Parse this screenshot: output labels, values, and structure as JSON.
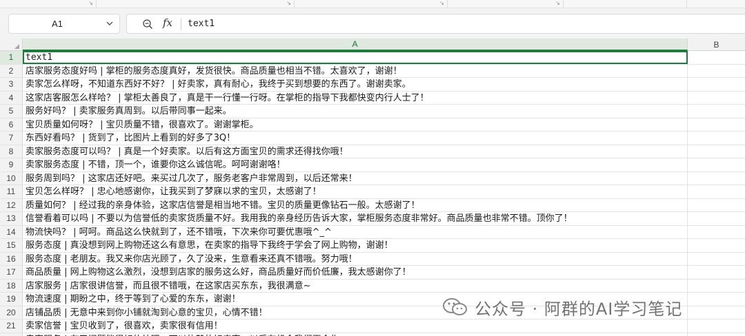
{
  "formula_bar": {
    "cell_reference": "A1",
    "fx_label": "fx",
    "content": "text1"
  },
  "columns": [
    "A",
    "B"
  ],
  "rows": [
    {
      "num": "1",
      "a": "text1"
    },
    {
      "num": "2",
      "a": "店家服务态度好吗 | 掌柜的服务态度真好，发货很快。商品质量也相当不错。太喜欢了，谢谢！"
    },
    {
      "num": "3",
      "a": "卖家怎么样呀，不知道东西好不好？ | 好卖家，真有耐心，我终于买到想要的东西了。谢谢卖家。"
    },
    {
      "num": "4",
      "a": "这家店客服怎么样哈？ | 掌柜太善良了，真是干一行懂一行呀。在掌柜的指导下我都快变内行人士了！"
    },
    {
      "num": "5",
      "a": "服务好吗？ | 卖家服务真周到。以后带同事一起来。"
    },
    {
      "num": "6",
      "a": "宝贝质量如何呀？ | 宝贝质量不错，很喜欢了。谢谢掌柜。"
    },
    {
      "num": "7",
      "a": "东西好看吗？ | 货到了，比图片上看到的好多了3Q！"
    },
    {
      "num": "8",
      "a": "卖家服务态度可以吗？ | 真是一个好卖家。以后有这方面宝贝的需求还得找你哦！"
    },
    {
      "num": "9",
      "a": "卖家服务态度 | 不错，顶一个，谁要你这么诚信呢。呵呵谢谢咯！"
    },
    {
      "num": "10",
      "a": "服务周到吗？ | 这家店还好吧。来买过几次了，服务老客户非常周到，以后还常来！"
    },
    {
      "num": "11",
      "a": "宝贝怎么样呀？ | 忠心地感谢你，让我买到了梦寐以求的宝贝，太感谢了！"
    },
    {
      "num": "12",
      "a": "质量如何？ | 经过我的亲身体验，这家店信誉是相当地不错。宝贝的质量更像钻石一般。太感谢了！"
    },
    {
      "num": "13",
      "a": "信誉看着可以吗 | 不要以为信誉低的卖家货质量不好。我用我的亲身经历告诉大家，掌柜服务态度非常好。商品质量也非常不错。顶你了！"
    },
    {
      "num": "14",
      "a": "物流快吗？ | 呵呵。商品这么快就到了，还不错哦，下次来你可要优惠哦^_^"
    },
    {
      "num": "15",
      "a": "服务态度 | 真没想到网上购物还这么有意思，在卖家的指导下我终于学会了网上购物，谢谢！"
    },
    {
      "num": "16",
      "a": "服务态度 | 老朋友。我又来你店光顾了，久了没来，生意看来还真不错哦。努力哦！"
    },
    {
      "num": "17",
      "a": "商品质量 | 网上购物这么激烈，没想到店家的服务这么好，商品质量好而价低廉，我太感谢你了！"
    },
    {
      "num": "18",
      "a": "店家服务 | 店家很讲信誉，而且很不错哦，在这家店买东东，我很满意~"
    },
    {
      "num": "19",
      "a": "物流速度 | 期盼之中，终于等到了心爱的东东，谢谢！"
    },
    {
      "num": "20",
      "a": "店铺品质 | 无意中来到你小铺就淘到心意的宝贝，心情不错！"
    },
    {
      "num": "21",
      "a": "卖家信誉 | 宝贝收到了，很喜欢，卖家很有信用！"
    },
    {
      "num": "22",
      "a": "卖家服务 | 有了问题能很好的处理，可以信赖的好店家，以后有机会我们再合作。"
    }
  ],
  "watermark": {
    "text": "公众号 · 阿群的AI学习笔记",
    "icon": "wechat-icon"
  }
}
